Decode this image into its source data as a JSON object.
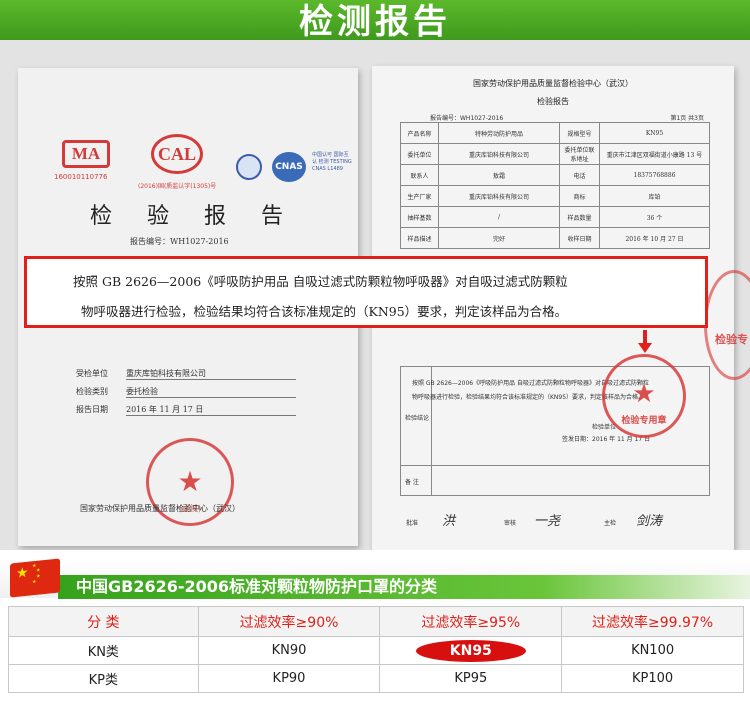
{
  "banner": {
    "title": "检测报告"
  },
  "certificate": {
    "watermark": "检 验 报 告",
    "ma_logo": "MA",
    "ma_number": "160010110776",
    "cal_logo": "CAL",
    "cal_number": "(2016)国(质监认字(1305)号",
    "cnas_logo": "CNAS",
    "cnas_caption": "中国认可 国际互认 检测 TESTING CNAS L1489",
    "title": "检 验 报 告",
    "report_number": "报告编号：WH1027-2016",
    "rows": [
      {
        "label": "受检单位",
        "value": "重庆库铂科技有限公司"
      },
      {
        "label": "检验类别",
        "value": "委托检验"
      },
      {
        "label": "报告日期",
        "value": "2016 年 11 月 17 日"
      }
    ],
    "seal_text": "(武汉)",
    "footer_org": "国家劳动保护用品质量监督检验中心（武汉）"
  },
  "report": {
    "org": "国家劳动保护用品质量监督检验中心（武汉）",
    "title": "检验报告",
    "meta_left": "报告编号：WH1027-2016",
    "meta_right": "第1页 共3页",
    "table": [
      [
        "产品名称",
        "特种劳动防护用品",
        "规格型号",
        "KN95"
      ],
      [
        "委托单位",
        "重庆库铂科技有限公司",
        "委托单位联系地址",
        "重庆市江津区双福街道小康路 13 号"
      ],
      [
        "联系人",
        "敖霜",
        "电话",
        "18375768886"
      ],
      [
        "生产厂家",
        "重庆库铂科技有限公司",
        "商标",
        "库铂"
      ],
      [
        "抽样基数",
        "/",
        "样品数量",
        "36 个"
      ],
      [
        "样品描述",
        "完好",
        "收样日期",
        "2016 年 10 月 27 日"
      ]
    ],
    "conclusion_label": "检验结论",
    "conclusion_lines": [
      "按照 GB 2626—2006《呼吸防护用品 自吸过滤式防颗粒物呼吸器》对自吸过滤式防颗粒",
      "物呼吸器进行检验，检验结果均符合该标准规定的（KN95）要求，判定该样品为合格。",
      "检验单位",
      "签发日期：2016 年 11 月 17 日"
    ],
    "note_label": "备 注",
    "seal_text": "检验专用章",
    "side_seal_text": "检验专",
    "signatures": {
      "approve_label": "批准",
      "approve_sig": "洪",
      "review_label": "审核",
      "review_sig": "一尧",
      "test_label": "主检",
      "test_sig": "剑涛"
    }
  },
  "callout": {
    "line1": "按照 GB 2626—2006《呼吸防护用品  自吸过滤式防颗粒物呼吸器》对自吸过滤式防颗粒",
    "line2": "物呼吸器进行检验，检验结果均符合该标准规定的（KN95）要求，判定该样品为合格。"
  },
  "classification": {
    "title": "中国GB2626-2006标准对颗粒物防护口罩的分类",
    "header": [
      "分 类",
      "过滤效率≥90%",
      "过滤效率≥95%",
      "过滤效率≥99.97%"
    ],
    "rows": [
      [
        "KN类",
        "KN90",
        "KN95",
        "KN100"
      ],
      [
        "KP类",
        "KP90",
        "KP95",
        "KP100"
      ]
    ]
  }
}
